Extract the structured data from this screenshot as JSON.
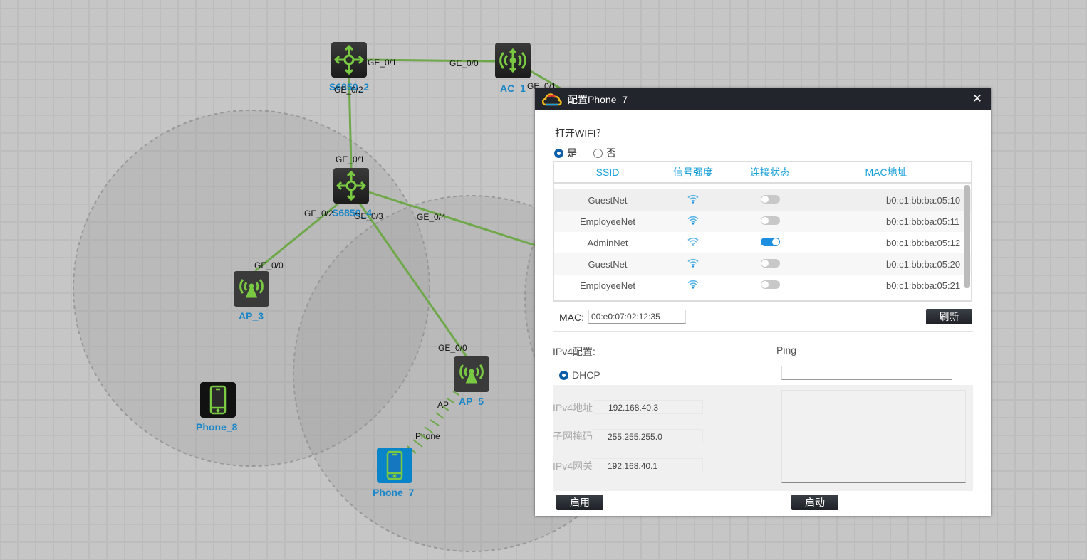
{
  "topology": {
    "devices": [
      {
        "name": "S6850_2",
        "type": "switch"
      },
      {
        "name": "AC_1",
        "type": "ac"
      },
      {
        "name": "S6850_4",
        "type": "switch"
      },
      {
        "name": "AP_3",
        "type": "ap"
      },
      {
        "name": "AP_5",
        "type": "ap"
      },
      {
        "name": "Phone_8",
        "type": "phone"
      },
      {
        "name": "Phone_7",
        "type": "phone",
        "selected": true
      }
    ],
    "ports": {
      "s2_ge01": "GE_0/1",
      "ac_ge00": "GE_0/0",
      "ac_ge01": "GE_0/1",
      "s2_ge02": "GE_0/2",
      "s4_ge01": "GE_0/1",
      "s4_ge02": "GE_0/2",
      "s4_ge03": "GE_0/3",
      "s4_ge04": "GE_0/4",
      "ap3_ge00": "GE_0/0",
      "ap5_ge00": "GE_0/0"
    },
    "wireless": {
      "ap_end": "AP",
      "phone_end": "Phone"
    },
    "colors": {
      "link": "#6fa84a",
      "icon": "#7ac943",
      "label": "#1a86c8",
      "selected": "#0a84c8"
    }
  },
  "dialog": {
    "title": "配置Phone_7",
    "wifi_question": "打开WIFI？",
    "wifi_yes": "是",
    "wifi_no": "否",
    "wifi_on": true,
    "columns": [
      "SSID",
      "信号强度",
      "连接状态",
      "MAC地址"
    ],
    "networks": [
      {
        "ssid": "GuestNet",
        "connected": false,
        "mac": "b0:c1:bb:ba:05:10"
      },
      {
        "ssid": "EmployeeNet",
        "connected": false,
        "mac": "b0:c1:bb:ba:05:11"
      },
      {
        "ssid": "AdminNet",
        "connected": true,
        "mac": "b0:c1:bb:ba:05:12"
      },
      {
        "ssid": "GuestNet",
        "connected": false,
        "mac": "b0:c1:bb:ba:05:20"
      },
      {
        "ssid": "EmployeeNet",
        "connected": false,
        "mac": "b0:c1:bb:ba:05:21"
      }
    ],
    "mac_label": "MAC:",
    "mac_value": "00:e0:07:02:12:35",
    "refresh": "刷新",
    "ipv4_title": "IPv4配置:",
    "dhcp": "DHCP",
    "ipv4_addr_label": "IPv4地址:",
    "ipv4_addr": "192.168.40.3",
    "mask_label": "子网掩码:",
    "mask": "255.255.255.0",
    "gw_label": "IPv4网关:",
    "gw": "192.168.40.1",
    "enable": "启用",
    "ping_title": "Ping",
    "ping_value": "",
    "start": "启动"
  }
}
